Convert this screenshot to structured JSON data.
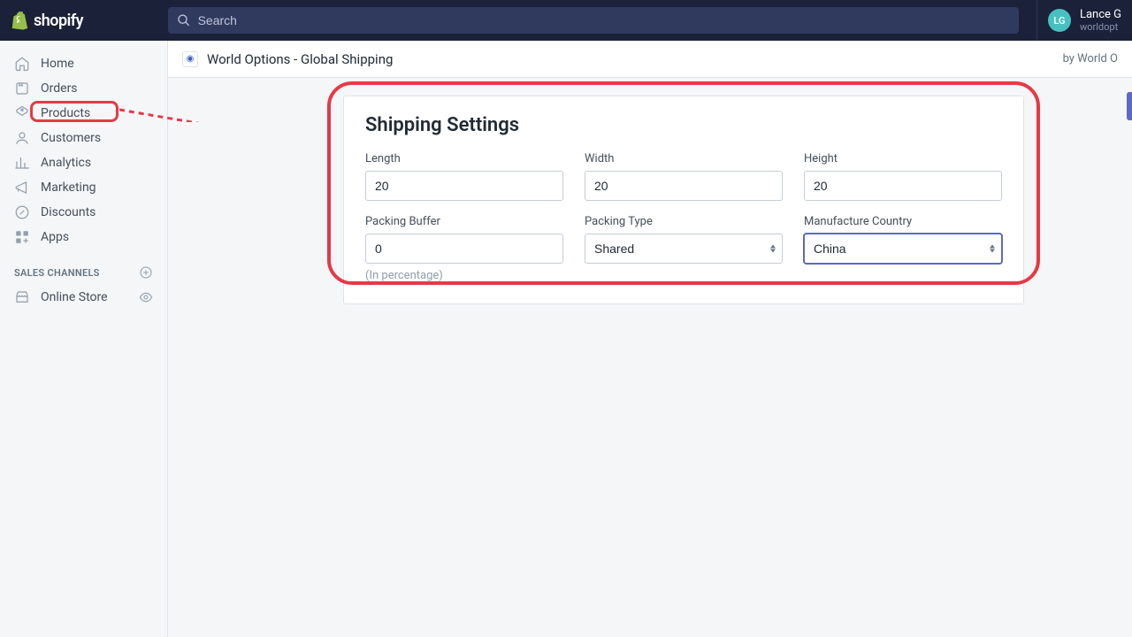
{
  "topbar": {
    "logo_text": "shopify",
    "search_placeholder": "Search",
    "user": {
      "initials": "LG",
      "name": "Lance G",
      "sub": "worldopt"
    }
  },
  "sidebar": {
    "items": [
      {
        "label": "Home"
      },
      {
        "label": "Orders"
      },
      {
        "label": "Products"
      },
      {
        "label": "Customers"
      },
      {
        "label": "Analytics"
      },
      {
        "label": "Marketing"
      },
      {
        "label": "Discounts"
      },
      {
        "label": "Apps"
      }
    ],
    "section_label": "SALES CHANNELS",
    "channel": {
      "label": "Online Store"
    }
  },
  "app_header": {
    "title": "World Options - Global Shipping",
    "by": "by World O"
  },
  "settings": {
    "title": "Shipping Settings",
    "length_label": "Length",
    "length_value": "20",
    "width_label": "Width",
    "width_value": "20",
    "height_label": "Height",
    "height_value": "20",
    "buffer_label": "Packing Buffer",
    "buffer_value": "0",
    "buffer_help": "(In percentage)",
    "packing_type_label": "Packing Type",
    "packing_type_value": "Shared",
    "country_label": "Manufacture Country",
    "country_value": "China"
  },
  "annotation": {
    "color": "#e63946"
  }
}
